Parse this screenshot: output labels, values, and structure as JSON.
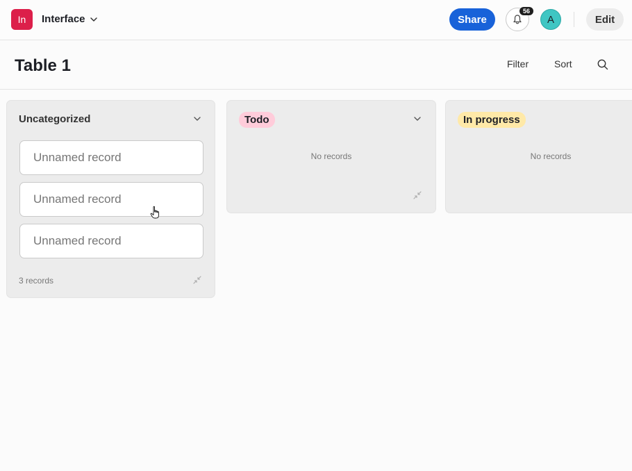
{
  "header": {
    "app_badge": "In",
    "app_name": "Interface",
    "share_label": "Share",
    "notification_count": "56",
    "avatar_initial": "A",
    "edit_label": "Edit"
  },
  "toolbar": {
    "title": "Table 1",
    "filter_label": "Filter",
    "sort_label": "Sort"
  },
  "columns": [
    {
      "title": "Uncategorized",
      "records": [
        "Unnamed record",
        "Unnamed record",
        "Unnamed record"
      ],
      "count_label": "3 records"
    },
    {
      "title": "Todo",
      "tag_color": "#ffccda",
      "empty_label": "No records"
    },
    {
      "title": "In progress",
      "tag_color": "#ffe9a8",
      "empty_label": "No records"
    }
  ],
  "colors": {
    "accent": "#1862d9",
    "app_badge": "#dc1f4a",
    "avatar": "#3fc6c3"
  },
  "icons": [
    "chevron-down-icon",
    "bell-icon",
    "search-icon",
    "collapse-icon",
    "hand-cursor-icon"
  ]
}
